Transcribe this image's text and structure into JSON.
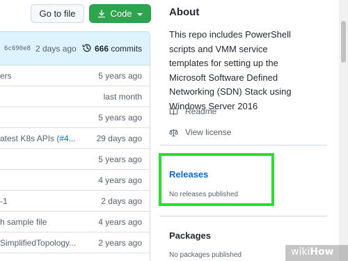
{
  "toolbar": {
    "goto_file_label": "Go to file",
    "code_label": "Code"
  },
  "commit_bar": {
    "sha": "6c690e8",
    "time_ago": "2 days ago",
    "commit_count": "666",
    "commits_label": "commits"
  },
  "files": [
    {
      "message": "ers",
      "ref": "",
      "when": "5 years ago"
    },
    {
      "message": "",
      "ref": "",
      "when": "last month"
    },
    {
      "message": "",
      "ref": "",
      "when": "5 years ago"
    },
    {
      "message": "atest K8s APIs (",
      "ref": "#4...",
      "when": "29 days ago"
    },
    {
      "message": "",
      "ref": "",
      "when": "5 years ago"
    },
    {
      "message": "",
      "ref": "",
      "when": "4 years ago"
    },
    {
      "message": "-1",
      "ref": "",
      "when": "2 days ago"
    },
    {
      "message": "h sample file",
      "ref": "",
      "when": "4 years ago"
    },
    {
      "message": "SimplifiedTopology...",
      "ref": "",
      "when": "2 years ago"
    }
  ],
  "about": {
    "title": "About",
    "description": "This repo includes PowerShell scripts and VMM service templates for setting up the Microsoft Software Defined Networking (SDN) Stack using Windows Server 2016",
    "readme_label": "Readme",
    "license_label": "View license"
  },
  "releases": {
    "title": "Releases",
    "empty_text": "No releases published"
  },
  "packages": {
    "title": "Packages",
    "empty_text": "No packages published"
  },
  "watermark": {
    "wiki": "wiki",
    "how": "How"
  },
  "colors": {
    "accent_green": "#2da44e",
    "link_blue": "#0969da",
    "highlight_green": "#27e02a"
  }
}
